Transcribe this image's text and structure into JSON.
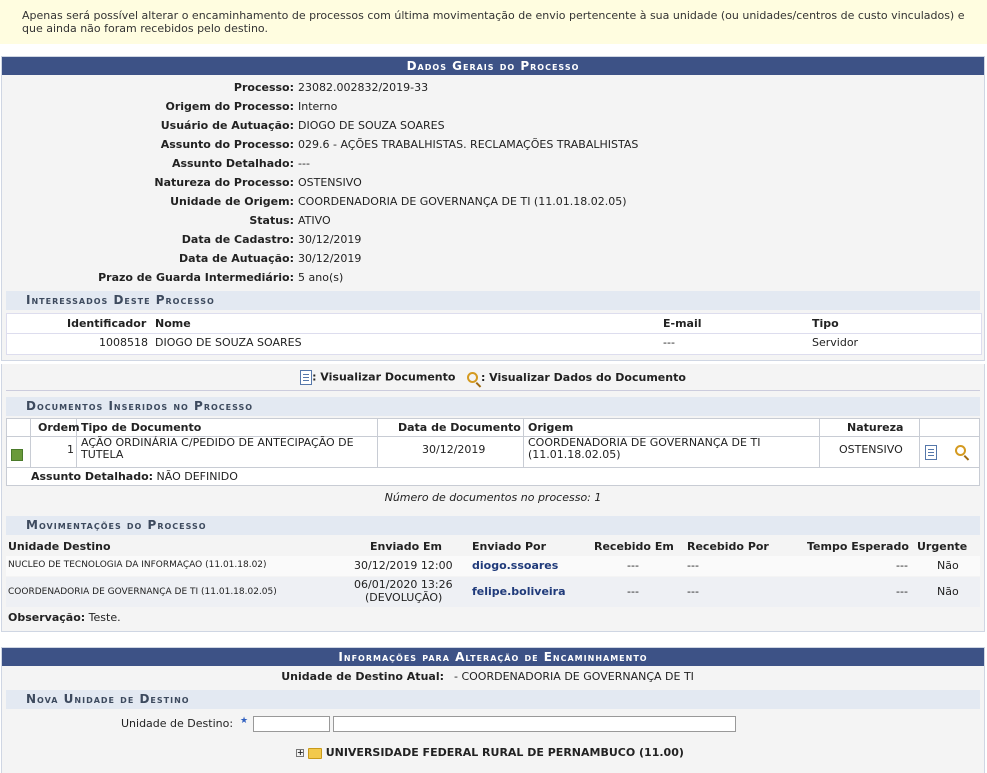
{
  "notice": "Apenas será possível alterar o encaminhamento de processos com última movimentação de envio pertencente à sua unidade (ou unidades/centros de custo vinculados) e que ainda não foram recebidos pelo destino.",
  "dados": {
    "title": "Dados Gerais do Processo",
    "fields": [
      {
        "label": "Processo:",
        "value": "23082.002832/2019-33"
      },
      {
        "label": "Origem do Processo:",
        "value": "Interno"
      },
      {
        "label": "Usuário de Autuação:",
        "value": "DIOGO DE SOUZA SOARES"
      },
      {
        "label": "Assunto do Processo:",
        "value": "029.6 - AÇÕES TRABALHISTAS. RECLAMAÇÕES TRABALHISTAS"
      },
      {
        "label": "Assunto Detalhado:",
        "value": "---"
      },
      {
        "label": "Natureza do Processo:",
        "value": "OSTENSIVO"
      },
      {
        "label": "Unidade de Origem:",
        "value": "COORDENADORIA DE GOVERNANÇA DE TI (11.01.18.02.05)"
      },
      {
        "label": "Status:",
        "value": "ATIVO"
      },
      {
        "label": "Data de Cadastro:",
        "value": "30/12/2019"
      },
      {
        "label": "Data de Autuação:",
        "value": "30/12/2019"
      },
      {
        "label": "Prazo de Guarda Intermediário:",
        "value": "5 ano(s)"
      }
    ]
  },
  "interessados": {
    "title": "Interessados Deste Processo",
    "headers": {
      "id": "Identificador",
      "nome": "Nome",
      "email": "E-mail",
      "tipo": "Tipo"
    },
    "rows": [
      {
        "id": "1008518",
        "nome": "DIOGO DE SOUZA SOARES",
        "email": "---",
        "tipo": "Servidor"
      }
    ]
  },
  "legend": {
    "view_doc": ": Visualizar Documento",
    "view_data": ": Visualizar Dados do Documento"
  },
  "documentos": {
    "title": "Documentos Inseridos no Processo",
    "headers": {
      "ordem": "Ordem",
      "tipo": "Tipo de Documento",
      "data": "Data de Documento",
      "origem": "Origem",
      "natureza": "Natureza"
    },
    "rows": [
      {
        "ordem": "1",
        "tipo_l1": "AÇÃO ORDINÁRIA C/PEDIDO DE ANTECIPAÇÃO DE",
        "tipo_l2": "TUTELA",
        "data": "30/12/2019",
        "origem_l1": "COORDENADORIA DE GOVERNANÇA DE TI",
        "origem_l2": "(11.01.18.02.05)",
        "natureza": "OSTENSIVO"
      }
    ],
    "assunto_label": "Assunto Detalhado:",
    "assunto_value": "NÃO DEFINIDO",
    "count": "Número de documentos no processo: 1"
  },
  "movimentacoes": {
    "title": "Movimentações do Processo",
    "headers": {
      "destino": "Unidade Destino",
      "enviado_em": "Enviado Em",
      "enviado_por": "Enviado Por",
      "recebido_em": "Recebido Em",
      "recebido_por": "Recebido Por",
      "tempo": "Tempo Esperado",
      "urgente": "Urgente"
    },
    "rows": [
      {
        "destino": "NUCLEO DE TECNOLOGIA DA INFORMAÇAO (11.01.18.02)",
        "enviado_em_l1": "30/12/2019 12:00",
        "enviado_em_l2": "",
        "enviado_por": "diogo.ssoares",
        "recebido_em": "---",
        "recebido_por": "---",
        "tempo": "---",
        "urgente": "Não"
      },
      {
        "destino": "COORDENADORIA DE GOVERNANÇA DE TI (11.01.18.02.05)",
        "enviado_em_l1": "06/01/2020 13:26",
        "enviado_em_l2": "(DEVOLUÇÃO)",
        "enviado_por": "felipe.boliveira",
        "recebido_em": "---",
        "recebido_por": "---",
        "tempo": "---",
        "urgente": "Não"
      }
    ],
    "obs_label": "Observação:",
    "obs_value": "Teste."
  },
  "alteracao": {
    "title": "Informações para Alteração de Encaminhamento",
    "atual_label": "Unidade de Destino Atual:",
    "atual_value": "- COORDENADORIA DE GOVERNANÇA DE TI",
    "nova_title": "Nova Unidade de Destino",
    "destino_label": "Unidade de Destino:",
    "required_mark": "★",
    "tree_root": "UNIVERSIDADE FEDERAL RURAL DE PERNAMBUCO (11.00)"
  },
  "colors": {
    "header_bg": "#3d5286",
    "subhead_bg": "#e3e9f2",
    "notice_bg": "#fffde0",
    "link": "#1f3a7a"
  }
}
